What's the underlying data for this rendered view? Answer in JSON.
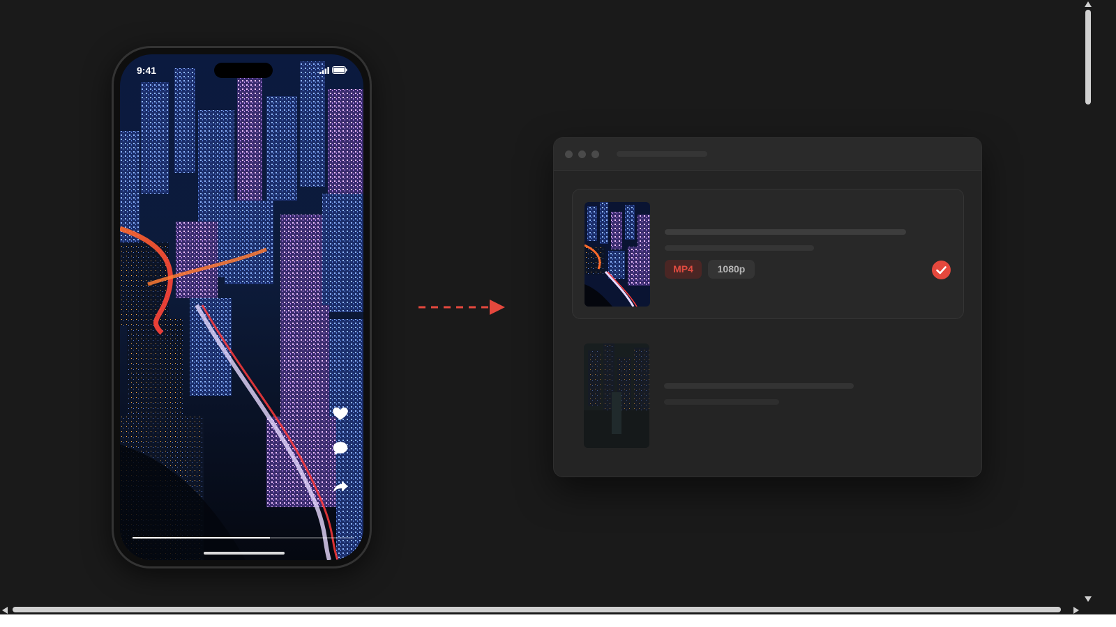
{
  "phone": {
    "status_time": "9:41",
    "video_progress_percent": 62,
    "actions": [
      "heart-icon",
      "comment-icon",
      "share-icon"
    ]
  },
  "download_window": {
    "items": [
      {
        "format": "MP4",
        "quality": "1080p",
        "status": "complete",
        "status_icon": "check-circle-icon"
      },
      {
        "status": "pending"
      }
    ]
  },
  "colors": {
    "background": "#1a1a1a",
    "window": "#242424",
    "accent": "#e5483d",
    "format_badge_bg": "#4a2624",
    "format_badge_text": "#e04b40",
    "quality_badge_bg": "#343434",
    "quality_badge_text": "#b5b5b5"
  }
}
